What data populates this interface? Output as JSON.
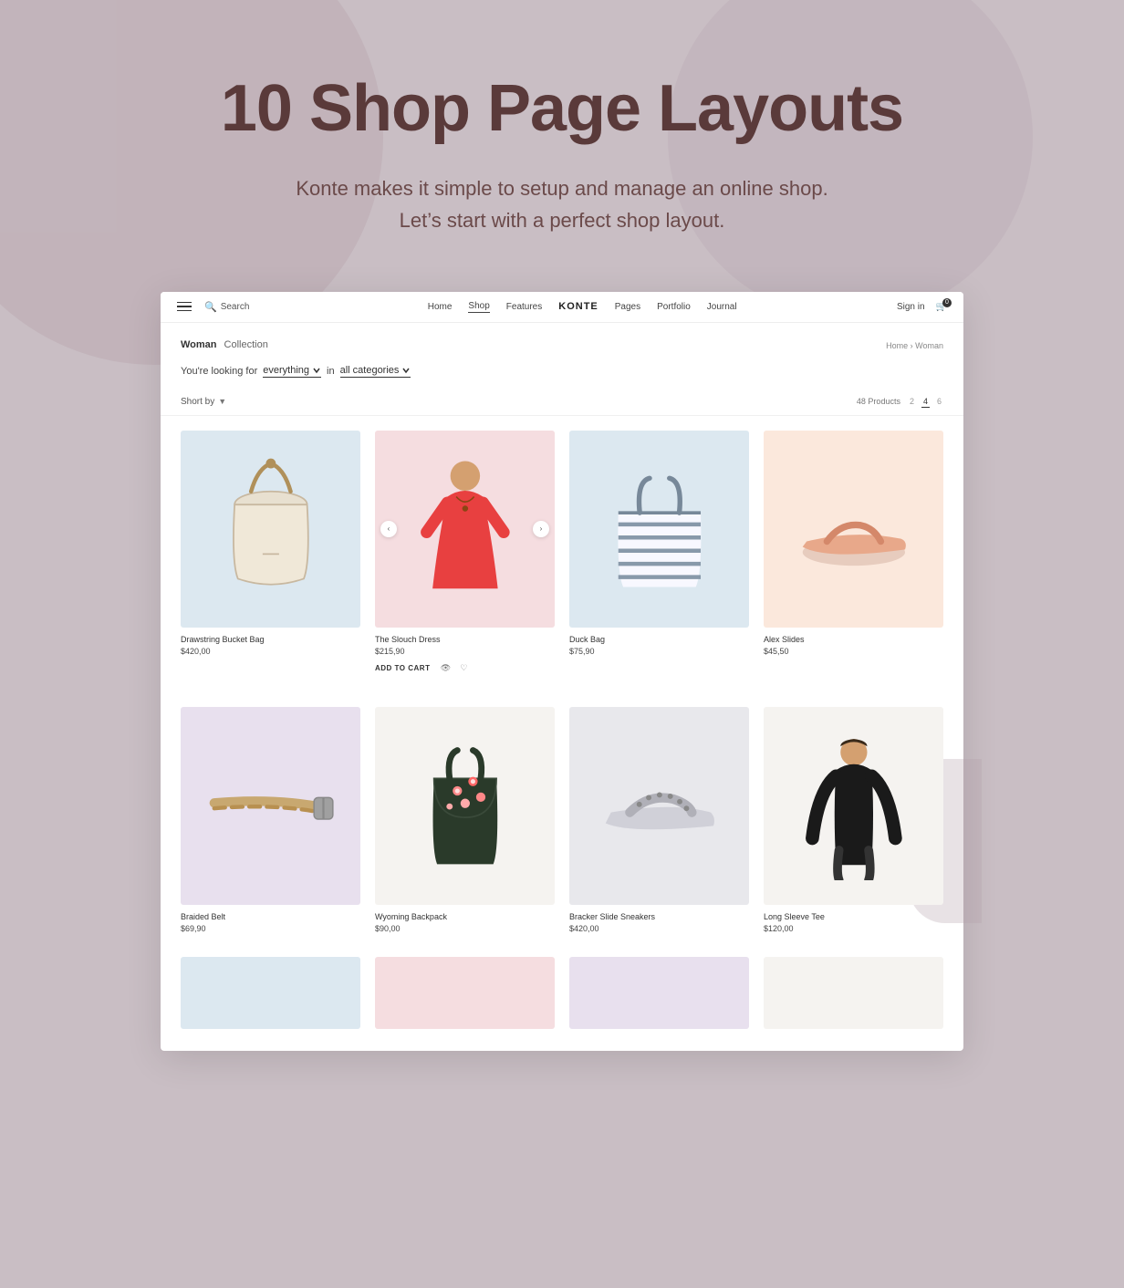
{
  "hero": {
    "title": "10 Shop Page Layouts",
    "subtitle_line1": "Konte makes it simple to setup and manage an online shop.",
    "subtitle_line2": "Let’s start with a perfect shop layout."
  },
  "navbar": {
    "search_label": "Search",
    "links": [
      {
        "label": "Home",
        "active": false
      },
      {
        "label": "Shop",
        "active": true
      },
      {
        "label": "Features",
        "active": false
      },
      {
        "label": "KONTE",
        "active": false,
        "brand": true
      },
      {
        "label": "Pages",
        "active": false
      },
      {
        "label": "Portfolio",
        "active": false
      },
      {
        "label": "Journal",
        "active": false
      }
    ],
    "sign_in": "Sign in",
    "cart_count": "0"
  },
  "page_header": {
    "title": "Woman",
    "subtitle": "Collection",
    "breadcrumb_home": "Home",
    "breadcrumb_separator": "›",
    "breadcrumb_current": "Woman"
  },
  "filter_bar": {
    "prefix": "You're looking for",
    "dropdown1": "everything",
    "in_text": "in",
    "dropdown2": "all categories"
  },
  "sort_bar": {
    "sort_label": "Short by",
    "products_count": "48 Products",
    "col_options": [
      "2",
      "4",
      "6"
    ],
    "active_col": "4"
  },
  "products_row1": [
    {
      "name": "Drawstring Bucket Bag",
      "price": "$420,00",
      "bg": "bg-light-blue",
      "svg_type": "bag"
    },
    {
      "name": "The Slouch Dress",
      "price": "$215,90",
      "bg": "bg-light-pink",
      "svg_type": "dress",
      "featured": true,
      "add_to_cart": "ADD TO CART"
    },
    {
      "name": "Duck Bag",
      "price": "$75,90",
      "bg": "bg-light-blue",
      "svg_type": "tote"
    },
    {
      "name": "Alex Slides",
      "price": "$45,50",
      "bg": "bg-light-peach",
      "svg_type": "sandal"
    }
  ],
  "products_row2": [
    {
      "name": "Braided Belt",
      "price": "$69,90",
      "bg": "bg-light-lavender",
      "svg_type": "belt"
    },
    {
      "name": "Wyoming Backpack",
      "price": "$90,00",
      "bg": "bg-white-off",
      "svg_type": "backpack"
    },
    {
      "name": "Bracker Slide Sneakers",
      "price": "$420,00",
      "bg": "bg-light-gray",
      "svg_type": "sneaker"
    },
    {
      "name": "Long Sleeve Tee",
      "price": "$120,00",
      "bg": "bg-white-off",
      "svg_type": "tee"
    }
  ],
  "products_row3_partial": [
    {
      "name": "",
      "price": "",
      "bg": "bg-light-blue"
    },
    {
      "name": "",
      "price": "",
      "bg": "bg-light-pink"
    },
    {
      "name": "",
      "price": "",
      "bg": "bg-light-lavender"
    },
    {
      "name": "",
      "price": "",
      "bg": "bg-white-off"
    }
  ]
}
